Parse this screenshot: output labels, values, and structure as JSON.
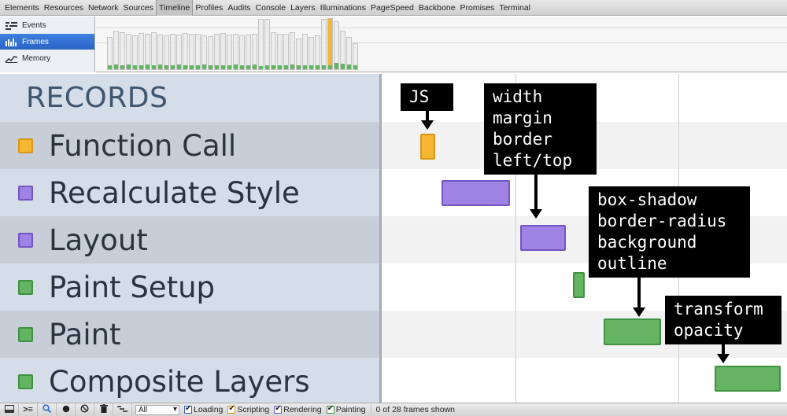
{
  "tabs": [
    "Elements",
    "Resources",
    "Network",
    "Sources",
    "Timeline",
    "Profiles",
    "Audits",
    "Console",
    "Layers",
    "Illuminations",
    "PageSpeed",
    "Backbone",
    "Promises",
    "Terminal"
  ],
  "selected_tab": "Timeline",
  "overview": {
    "items": [
      {
        "label": "Events",
        "icon": "events-icon"
      },
      {
        "label": "Frames",
        "icon": "frames-icon",
        "selected": true
      },
      {
        "label": "Memory",
        "icon": "memory-icon"
      }
    ]
  },
  "records": {
    "title": "RECORDS",
    "items": [
      {
        "label": "Function Call",
        "color": "#f5b731",
        "border": "#d9961a"
      },
      {
        "label": "Recalculate Style",
        "color": "#9e82e4",
        "border": "#7356c3"
      },
      {
        "label": "Layout",
        "color": "#9e82e4",
        "border": "#7356c3"
      },
      {
        "label": "Paint Setup",
        "color": "#64b464",
        "border": "#3f9240"
      },
      {
        "label": "Paint",
        "color": "#64b464",
        "border": "#3f9240"
      },
      {
        "label": "Composite Layers",
        "color": "#64b464",
        "border": "#3f9240"
      }
    ]
  },
  "callouts": {
    "js": "JS",
    "layout_props": "width\nmargin\nborder\nleft/top",
    "paint_props": "box-shadow\nborder-radius\nbackground\noutline",
    "composite_props": "transform\nopacity"
  },
  "statusbar": {
    "filter_value": "All",
    "checks": [
      "Loading",
      "Scripting",
      "Rendering",
      "Painting"
    ],
    "frames_status": "0 of 28 frames shown"
  },
  "colors": {
    "scripting": "#f5b731",
    "rendering": "#9e82e4",
    "painting": "#64b464"
  }
}
